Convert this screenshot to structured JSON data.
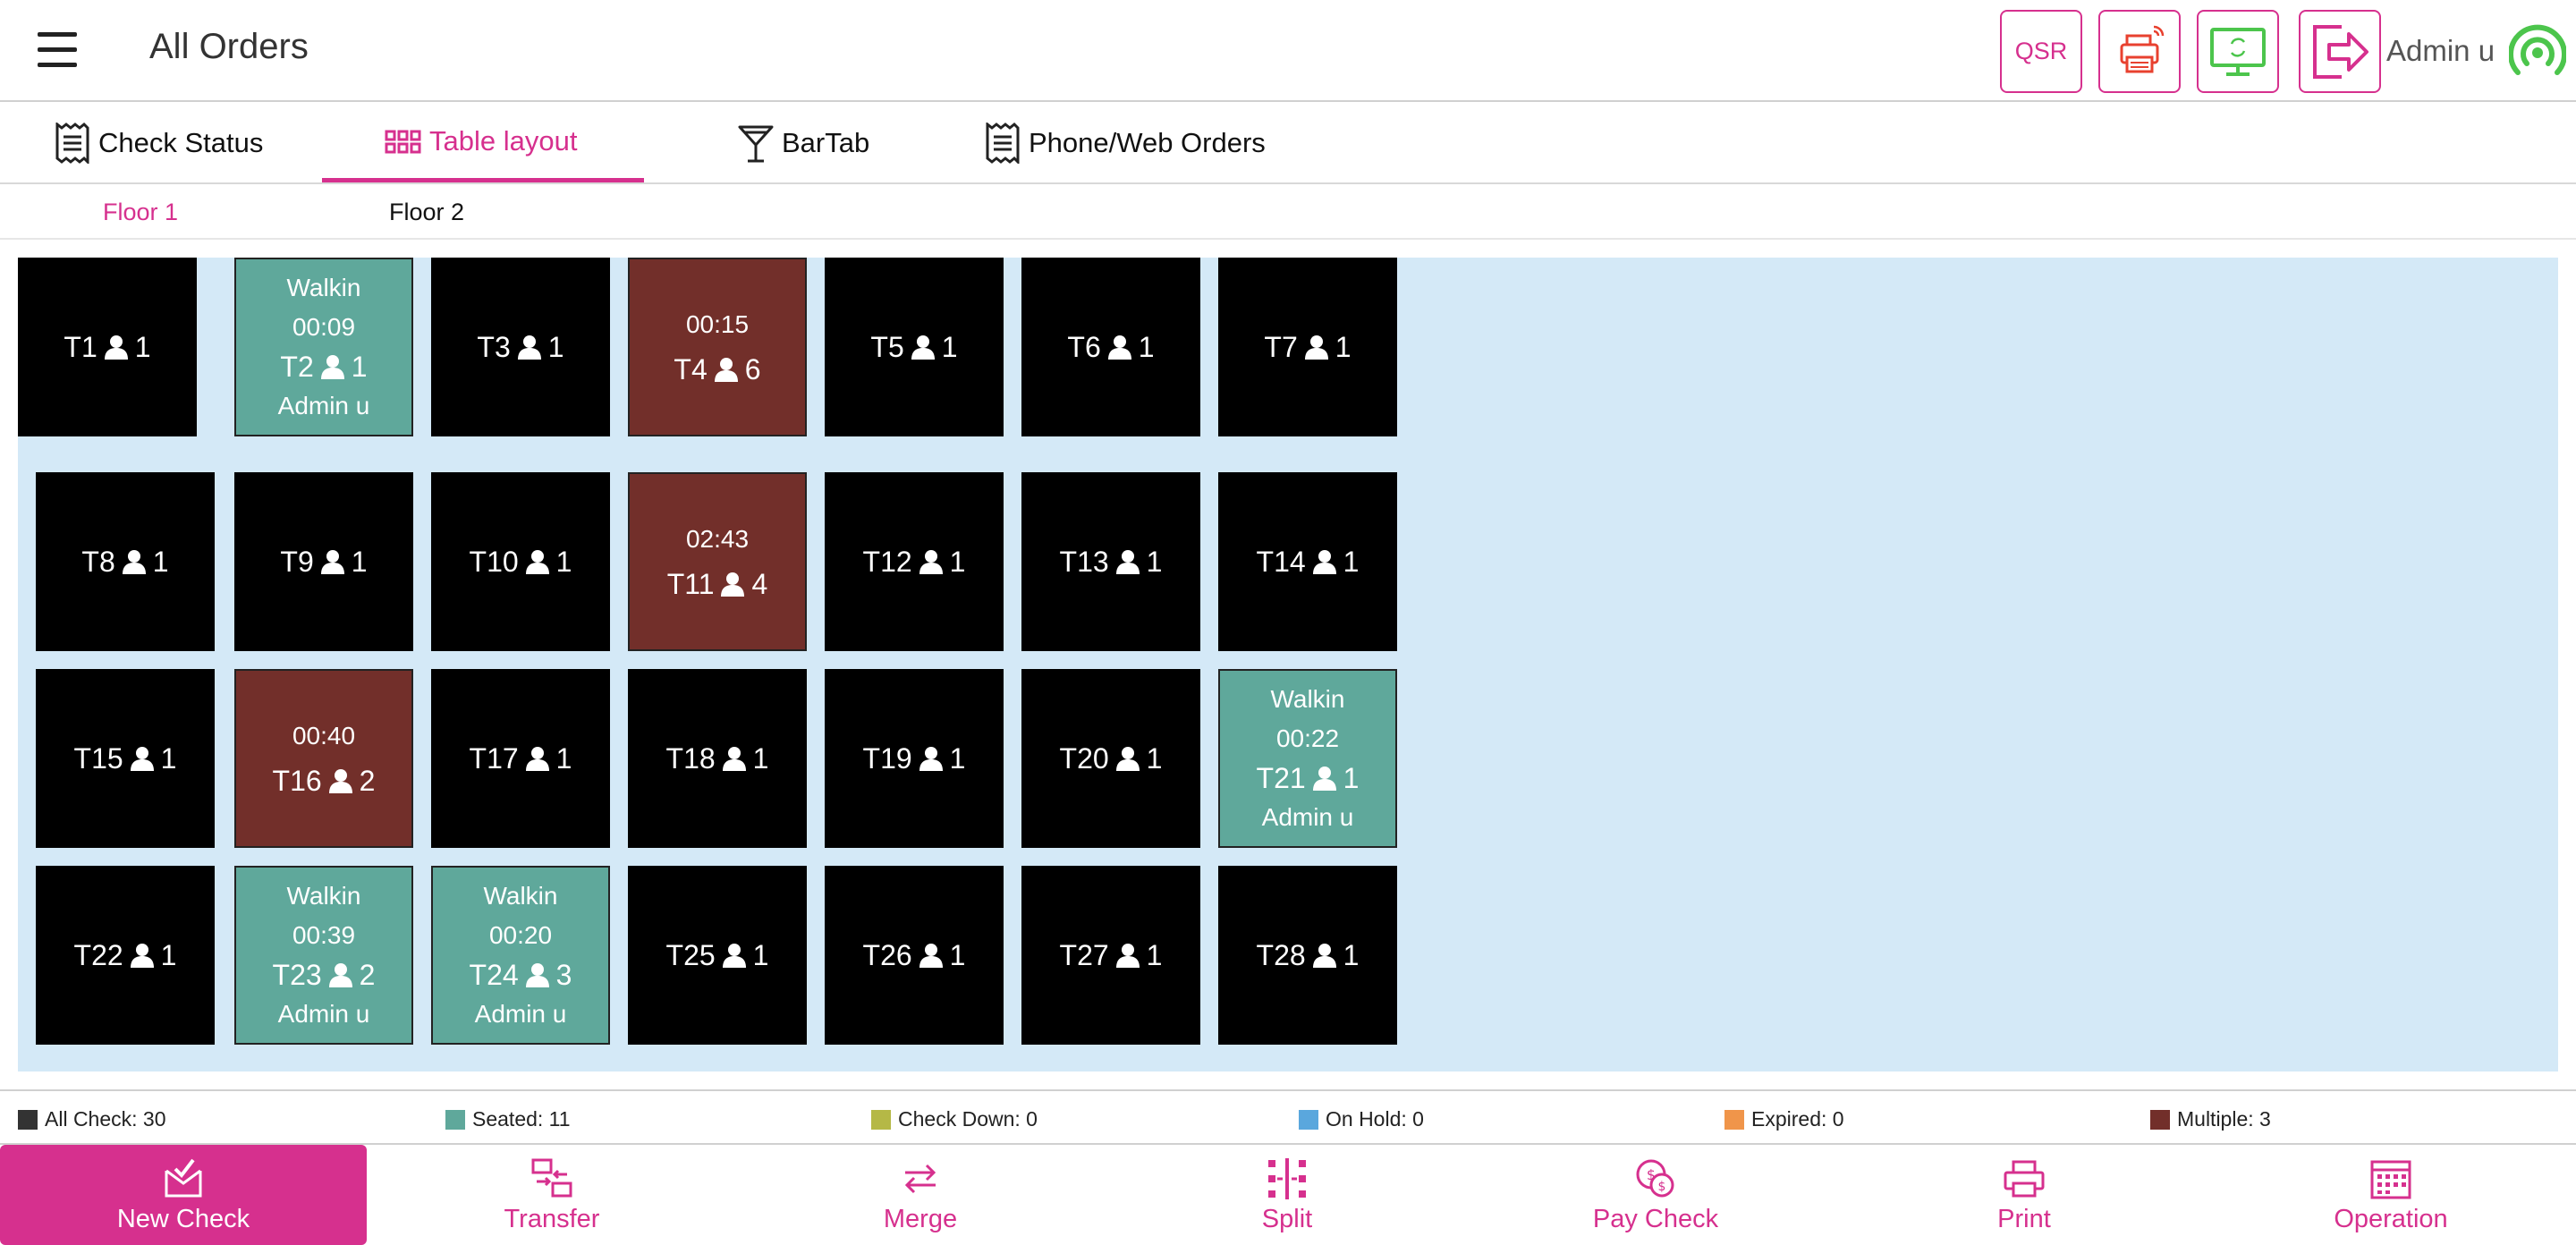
{
  "header": {
    "title": "All Orders",
    "qsr_label": "QSR",
    "user_name": "Admin u"
  },
  "tabs": [
    {
      "label": "Check Status",
      "icon": "receipt-icon",
      "active": false
    },
    {
      "label": "Table layout",
      "icon": "grid-icon",
      "active": true
    },
    {
      "label": "BarTab",
      "icon": "cocktail-glass-icon",
      "active": false
    },
    {
      "label": "Phone/Web Orders",
      "icon": "receipt-icon",
      "active": false
    }
  ],
  "floors": [
    {
      "label": "Floor 1",
      "active": true
    },
    {
      "label": "Floor 2",
      "active": false
    }
  ],
  "tables": [
    {
      "name": "T1",
      "guests": "1",
      "status": "empty"
    },
    {
      "name": "T2",
      "guests": "1",
      "status": "seated",
      "type": "Walkin",
      "time": "00:09",
      "server": "Admin u"
    },
    {
      "name": "T3",
      "guests": "1",
      "status": "empty"
    },
    {
      "name": "T4",
      "guests": "6",
      "status": "multiple",
      "time": "00:15"
    },
    {
      "name": "T5",
      "guests": "1",
      "status": "empty"
    },
    {
      "name": "T6",
      "guests": "1",
      "status": "empty"
    },
    {
      "name": "T7",
      "guests": "1",
      "status": "empty"
    },
    {
      "name": "T8",
      "guests": "1",
      "status": "empty"
    },
    {
      "name": "T9",
      "guests": "1",
      "status": "empty"
    },
    {
      "name": "T10",
      "guests": "1",
      "status": "empty"
    },
    {
      "name": "T11",
      "guests": "4",
      "status": "multiple",
      "time": "02:43"
    },
    {
      "name": "T12",
      "guests": "1",
      "status": "empty"
    },
    {
      "name": "T13",
      "guests": "1",
      "status": "empty"
    },
    {
      "name": "T14",
      "guests": "1",
      "status": "empty"
    },
    {
      "name": "T15",
      "guests": "1",
      "status": "empty"
    },
    {
      "name": "T16",
      "guests": "2",
      "status": "multiple",
      "time": "00:40"
    },
    {
      "name": "T17",
      "guests": "1",
      "status": "empty"
    },
    {
      "name": "T18",
      "guests": "1",
      "status": "empty"
    },
    {
      "name": "T19",
      "guests": "1",
      "status": "empty"
    },
    {
      "name": "T20",
      "guests": "1",
      "status": "empty"
    },
    {
      "name": "T21",
      "guests": "1",
      "status": "seated",
      "type": "Walkin",
      "time": "00:22",
      "server": "Admin u"
    },
    {
      "name": "T22",
      "guests": "1",
      "status": "empty"
    },
    {
      "name": "T23",
      "guests": "2",
      "status": "seated",
      "type": "Walkin",
      "time": "00:39",
      "server": "Admin u"
    },
    {
      "name": "T24",
      "guests": "3",
      "status": "seated",
      "type": "Walkin",
      "time": "00:20",
      "server": "Admin u"
    },
    {
      "name": "T25",
      "guests": "1",
      "status": "empty"
    },
    {
      "name": "T26",
      "guests": "1",
      "status": "empty"
    },
    {
      "name": "T27",
      "guests": "1",
      "status": "empty"
    },
    {
      "name": "T28",
      "guests": "1",
      "status": "empty"
    }
  ],
  "legend": [
    {
      "label": "All Check: 30",
      "color": "#333333"
    },
    {
      "label": "Seated: 11",
      "color": "#5fa89b"
    },
    {
      "label": "Check Down: 0",
      "color": "#b5b846"
    },
    {
      "label": "On Hold: 0",
      "color": "#5aa7dd"
    },
    {
      "label": "Expired: 0",
      "color": "#f0954a"
    },
    {
      "label": "Multiple: 3",
      "color": "#722f2a"
    }
  ],
  "actions": [
    {
      "label": "New Check",
      "icon": "new-check-icon"
    },
    {
      "label": "Transfer",
      "icon": "transfer-icon"
    },
    {
      "label": "Merge",
      "icon": "merge-icon"
    },
    {
      "label": "Split",
      "icon": "split-icon"
    },
    {
      "label": "Pay Check",
      "icon": "pay-check-icon"
    },
    {
      "label": "Print",
      "icon": "printer-icon"
    },
    {
      "label": "Operation",
      "icon": "calendar-icon"
    }
  ],
  "colors": {
    "accent": "#d6308e",
    "seated": "#5fa89b",
    "multiple": "#722f2a",
    "empty": "#000000",
    "floor_bg": "#d4e9f7"
  }
}
